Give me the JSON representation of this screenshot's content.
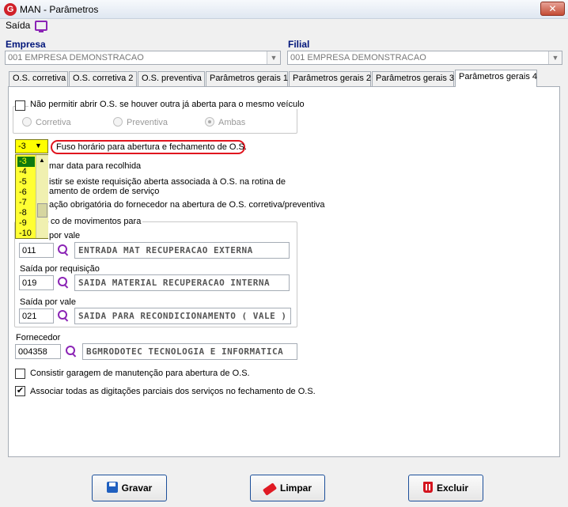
{
  "window": {
    "title": "MAN - Parâmetros",
    "logo": "G",
    "close": "✕"
  },
  "menu": {
    "saida": "Saída"
  },
  "empresa": {
    "label": "Empresa",
    "value": "001 EMPRESA DEMONSTRACAO"
  },
  "filial": {
    "label": "Filial",
    "value": "001 EMPRESA DEMONSTRACAO"
  },
  "tabs": [
    "O.S. corretiva",
    "O.S. corretiva 2",
    "O.S. preventiva",
    "Parâmetros gerais 1",
    "Parâmetros gerais 2",
    "Parâmetros gerais 3",
    "Parâmetros gerais 4"
  ],
  "active_tab": 6,
  "opts": {
    "nao_permitir": "Não permitir abrir O.S. se houver outra já aberta para o mesmo veículo",
    "radio_corretiva": "Corretiva",
    "radio_preventiva": "Preventiva",
    "radio_ambas": "Ambas",
    "fuso_value": "-3",
    "fuso_label": "Fuso horário para abertura e fechamento de O.S.",
    "fuso_options": [
      "-3",
      "-4",
      "-5",
      "-6",
      "-7",
      "-8",
      "-9",
      "-10"
    ],
    "line_data": "mar data para recolhida",
    "line_consistir_a": "istir se existe requisição aberta associada à O.S. na rotina de",
    "line_consistir_b": "amento de ordem de serviço",
    "line_fornecedor": "ação obrigatória do fornecedor na abertura de O.S. corretiva/preventiva",
    "group_mov": "co de movimentos para",
    "lbl_vale1": "por vale",
    "vale1_code": "011",
    "vale1_desc": "ENTRADA MAT RECUPERACAO EXTERNA",
    "lbl_req": "Saída por requisição",
    "req_code": "019",
    "req_desc": "SAIDA MATERIAL RECUPERACAO INTERNA",
    "lbl_vale2": "Saída por vale",
    "vale2_code": "021",
    "vale2_desc": "SAIDA PARA RECONDICIONAMENTO ( VALE )",
    "lbl_fornecedor": "Fornecedor",
    "forn_code": "004358",
    "forn_desc": "BGMRODOTEC TECNOLOGIA E INFORMATICA",
    "consistir_garagem": "Consistir garagem de manutenção para abertura de O.S.",
    "associar": "Associar todas as digitações parciais dos serviços no fechamento de O.S."
  },
  "buttons": {
    "gravar": "Gravar",
    "limpar": "Limpar",
    "excluir": "Excluir"
  }
}
